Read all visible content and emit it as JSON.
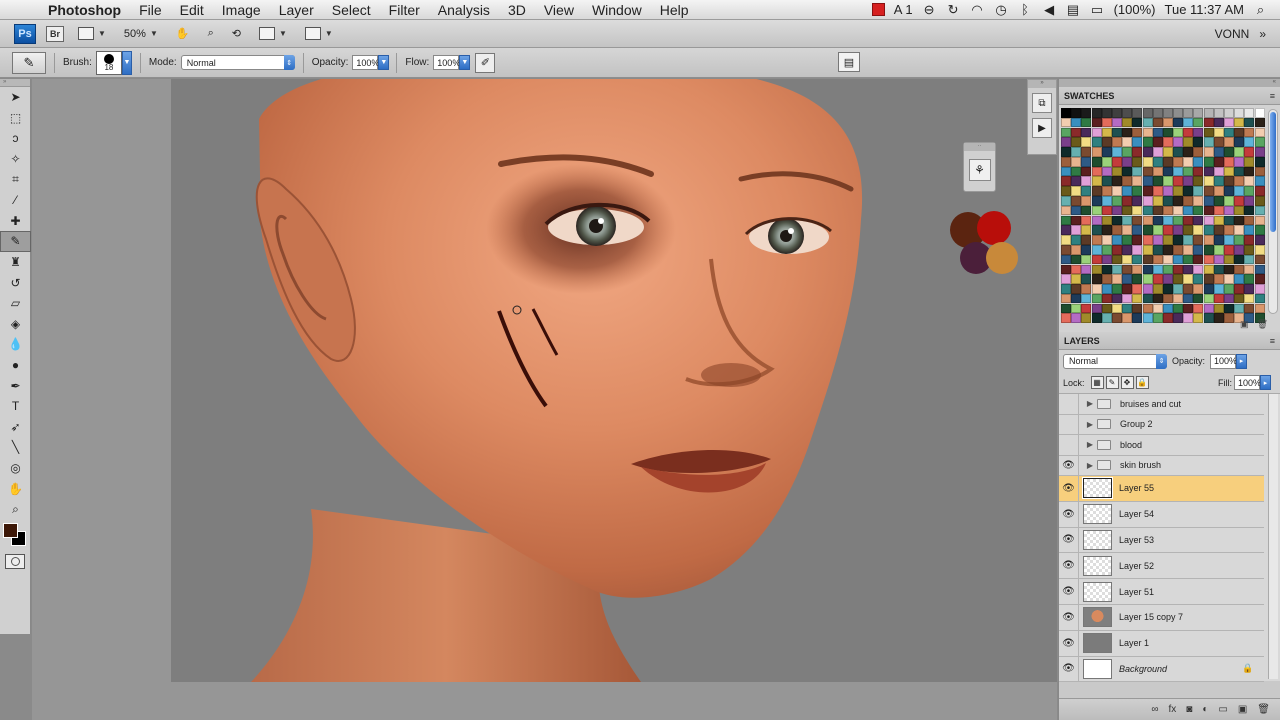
{
  "menubar": {
    "apple_icon": "apple-logo",
    "app_name": "Photoshop",
    "items": [
      "File",
      "Edit",
      "Image",
      "Layer",
      "Select",
      "Filter",
      "Analysis",
      "3D",
      "View",
      "Window",
      "Help"
    ],
    "status": {
      "input_menu": "A 1",
      "battery": "(100%)",
      "clock": "Tue 11:37 AM"
    }
  },
  "appbar": {
    "logo": "Ps",
    "bridge": "Br",
    "zoom": "50%",
    "workspace": "VONN"
  },
  "options": {
    "brush_label": "Brush:",
    "brush_size": "18",
    "mode_label": "Mode:",
    "mode_value": "Normal",
    "opacity_label": "Opacity:",
    "opacity_value": "100%",
    "flow_label": "Flow:",
    "flow_value": "100%"
  },
  "swatches_panel": {
    "title": "SWATCHES"
  },
  "layers_panel": {
    "title": "LAYERS",
    "blend_mode": "Normal",
    "opacity_label": "Opacity:",
    "opacity_value": "100%",
    "lock_label": "Lock:",
    "fill_label": "Fill:",
    "fill_value": "100%",
    "groups": [
      {
        "name": "bruises and cut",
        "visible": false
      },
      {
        "name": "Group 2",
        "visible": false
      },
      {
        "name": "blood",
        "visible": false
      },
      {
        "name": "skin brush",
        "visible": true
      }
    ],
    "layers": [
      {
        "name": "Layer 55",
        "selected": true
      },
      {
        "name": "Layer 54"
      },
      {
        "name": "Layer 53"
      },
      {
        "name": "Layer 52"
      },
      {
        "name": "Layer 51"
      },
      {
        "name": "Layer 15 copy 7"
      },
      {
        "name": "Layer 1"
      },
      {
        "name": "Background",
        "locked": true
      }
    ]
  },
  "colors": {
    "foreground": "#3d1808",
    "background": "#000000",
    "selection": "#f7cf7d"
  }
}
